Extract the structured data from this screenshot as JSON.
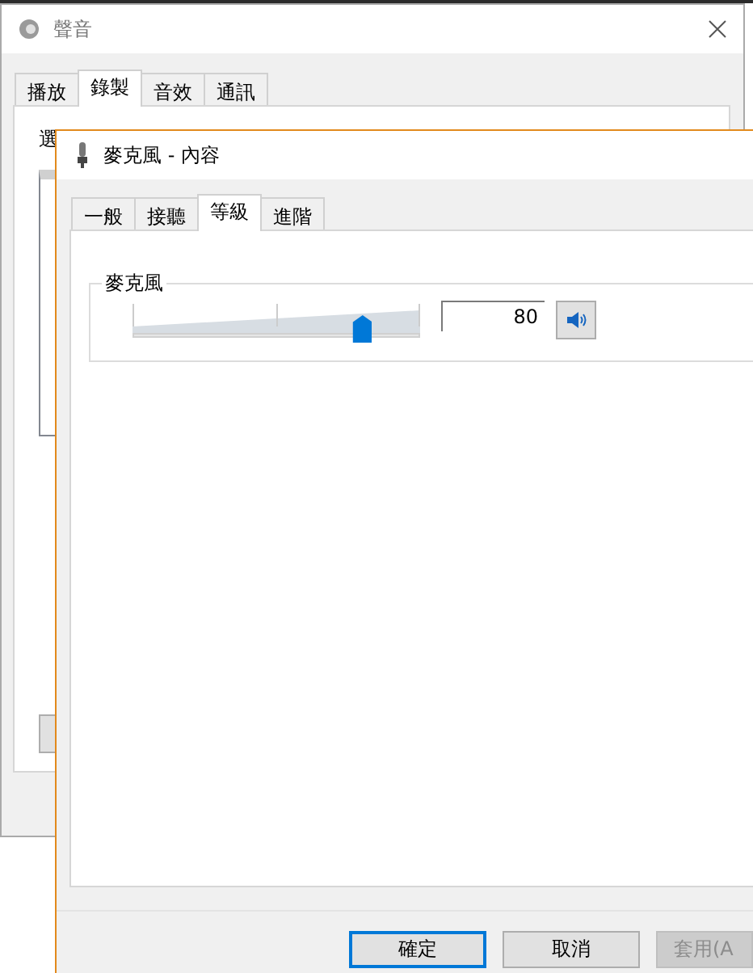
{
  "sound_window": {
    "title": "聲音",
    "tabs": [
      {
        "label": "播放",
        "selected": false
      },
      {
        "label": "錄製",
        "selected": true
      },
      {
        "label": "音效",
        "selected": false
      },
      {
        "label": "通訊",
        "selected": false
      }
    ],
    "instruction": "選"
  },
  "properties_window": {
    "title": "麥克風 - 內容",
    "tabs": [
      {
        "label": "一般",
        "selected": false
      },
      {
        "label": "接聽",
        "selected": false
      },
      {
        "label": "等級",
        "selected": true
      },
      {
        "label": "進階",
        "selected": false
      }
    ],
    "group_label": "麥克風",
    "level": 0.8,
    "value": "80",
    "muted": false,
    "buttons": [
      {
        "label": "確定",
        "kind": "default"
      },
      {
        "label": "取消",
        "kind": "normal"
      },
      {
        "label": "套用(A",
        "kind": "disabled"
      }
    ]
  }
}
